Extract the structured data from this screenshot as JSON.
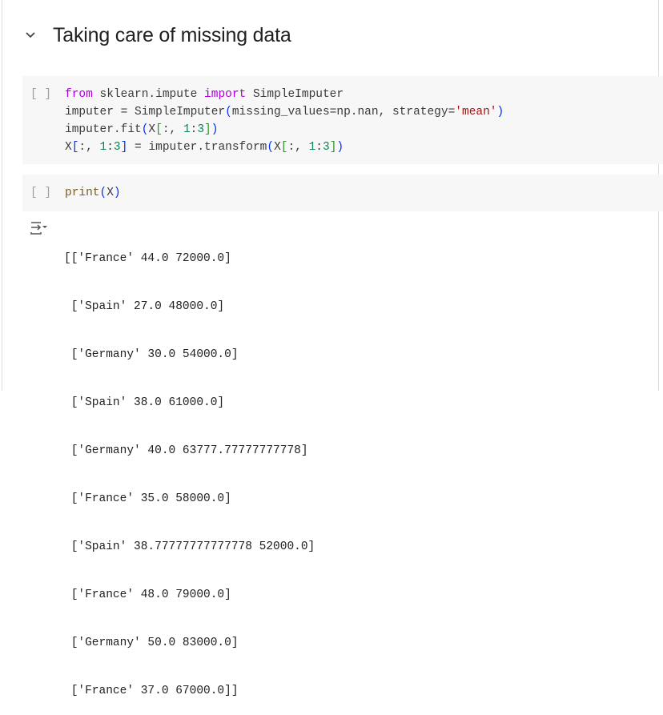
{
  "section": {
    "title": "Taking care of missing data",
    "icon": "chevron-down-icon"
  },
  "cells": [
    {
      "run_label": "[ ]",
      "lines": [
        [
          "from",
          " sklearn.impute ",
          "import",
          " SimpleImputer"
        ],
        [
          "imputer = SimpleImputer",
          "(",
          "missing_values=np.nan, strategy=",
          "'mean'",
          ")"
        ],
        [
          "imputer.fit",
          "(",
          "X",
          "[",
          ":, ",
          "1",
          ":",
          "3",
          "]",
          ")"
        ],
        [
          "X",
          "[",
          ":, ",
          "1",
          ":",
          "3",
          "]",
          " = imputer.transform",
          "(",
          "X",
          "[",
          ":, ",
          "1",
          ":",
          "3",
          "]",
          ")"
        ]
      ]
    },
    {
      "run_label": "[ ]",
      "lines": [
        [
          "print",
          "(",
          "X",
          ")"
        ]
      ]
    }
  ],
  "output": {
    "icon": "output-collapse-icon",
    "lines": [
      "[['France' 44.0 72000.0]",
      " ['Spain' 27.0 48000.0]",
      " ['Germany' 30.0 54000.0]",
      " ['Spain' 38.0 61000.0]",
      " ['Germany' 40.0 63777.77777777778]",
      " ['France' 35.0 58000.0]",
      " ['Spain' 38.77777777777778 52000.0]",
      " ['France' 48.0 79000.0]",
      " ['Germany' 50.0 83000.0]",
      " ['France' 37.0 67000.0]]"
    ]
  }
}
